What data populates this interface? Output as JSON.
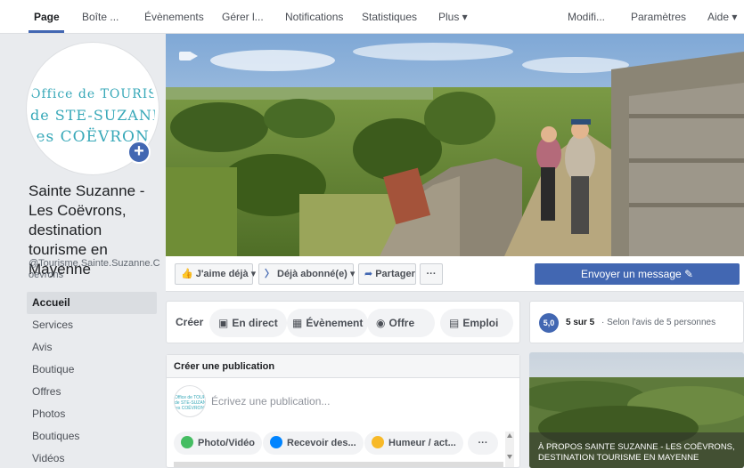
{
  "topnav": {
    "tabs": [
      "Page",
      "Boîte ...",
      "Évènements",
      "Gérer l...",
      "Notifications",
      "Statistiques",
      "Plus ▾"
    ],
    "right": [
      "Modifi...",
      "Paramètres",
      "Aide ▾"
    ]
  },
  "logo": {
    "line1": "Office de TOURISME",
    "line2": "de STE-SUZANNE",
    "line3": "les COËVRONS"
  },
  "page": {
    "name": "Sainte Suzanne - Les Coëvrons, destination tourisme en Mayenne",
    "handle": "@Tourisme.Sainte.Suzanne.Coevrons"
  },
  "nav": {
    "items": [
      "Accueil",
      "Services",
      "Avis",
      "Boutique",
      "Offres",
      "Photos",
      "Boutiques",
      "Vidéos"
    ]
  },
  "actions": {
    "like": "J'aime déjà ▾",
    "follow": "Déjà abonné(e) ▾",
    "share": "Partager",
    "more": "···",
    "message": "Envoyer un message ✎"
  },
  "create": {
    "label": "Créer",
    "live": "En direct",
    "event": "Évènement",
    "offer": "Offre",
    "job": "Emploi"
  },
  "publication": {
    "header": "Créer une publication",
    "placeholder": "Écrivez une publication...",
    "photo": "Photo/Vidéo",
    "receive": "Recevoir des...",
    "mood": "Humeur / act...",
    "more": "···"
  },
  "rating": {
    "score": "5,0",
    "label": "5 sur 5",
    "sub": "· Selon l'avis de 5 personnes"
  },
  "about": {
    "title": "À PROPOS SAINTE SUZANNE - LES COËVRONS, DESTINATION TOURISME EN MAYENNE"
  },
  "colors": {
    "brand": "#4267b2",
    "logo_teal": "#37a8b8"
  }
}
